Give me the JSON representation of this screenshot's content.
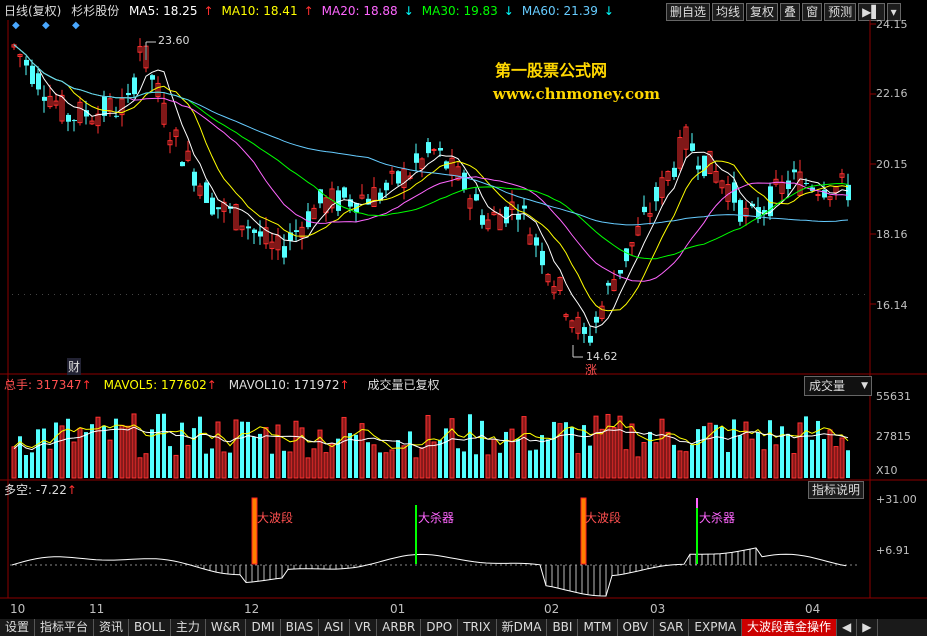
{
  "header": {
    "period": "日线(复权)",
    "stock": "杉杉股份",
    "ma": [
      {
        "label": "MA5: 18.25",
        "arrow": "↑",
        "color": "#ffffff",
        "arrowColor": "#ff3030"
      },
      {
        "label": "MA10: 18.41",
        "arrow": "↑",
        "color": "#ffff00",
        "arrowColor": "#ff3030"
      },
      {
        "label": "MA20: 18.88",
        "arrow": "↓",
        "color": "#ff66ff",
        "arrowColor": "#00ffff"
      },
      {
        "label": "MA30: 19.83",
        "arrow": "↓",
        "color": "#00ff00",
        "arrowColor": "#00ffff"
      },
      {
        "label": "MA60: 21.39",
        "arrow": "↓",
        "color": "#66ccff",
        "arrowColor": "#00ffff"
      }
    ]
  },
  "toolbar": {
    "buttons": [
      "删自选",
      "均线",
      "复权",
      "叠",
      "窗",
      "预测"
    ]
  },
  "watermark": {
    "title": "第一股票公式网",
    "url": "www.chnmoney.com"
  },
  "price_axis": [
    "24.15",
    "22.16",
    "20.15",
    "18.16",
    "16.14"
  ],
  "annotations": {
    "high": "23.60",
    "low": "14.62",
    "cai": "财",
    "zhang": "涨"
  },
  "volume": {
    "total_label": "总手: 317347",
    "total_arrow": "↑",
    "mavol5": "MAVOL5: 177602",
    "mavol5_arrow": "↑",
    "mavol10": "MAVOL10: 171972",
    "mavol10_arrow": "↑",
    "note": "成交量已复权",
    "selector": "成交量",
    "axis": [
      "55631",
      "27815",
      "X10"
    ]
  },
  "indicator": {
    "label": "多空: -7.22",
    "arrow": "↑",
    "button": "指标说明",
    "axis": [
      "+31.00",
      "+6.91"
    ],
    "signals": [
      "大波段",
      "大杀器",
      "大波段",
      "大杀器"
    ]
  },
  "x_axis": [
    "10",
    "11",
    "12",
    "01",
    "02",
    "03",
    "04"
  ],
  "tabs": [
    "设置",
    "指标平台",
    "资讯",
    "BOLL",
    "主力",
    "W&R",
    "DMI",
    "BIAS",
    "ASI",
    "VR",
    "ARBR",
    "DPO",
    "TRIX",
    "新DMA",
    "BBI",
    "MTM",
    "OBV",
    "SAR",
    "EXPMA",
    "大波段黄金操作"
  ],
  "colors": {
    "up": "#ff3030",
    "down": "#54ffff",
    "accent": "#c00000",
    "watermark": "#ffd700"
  }
}
